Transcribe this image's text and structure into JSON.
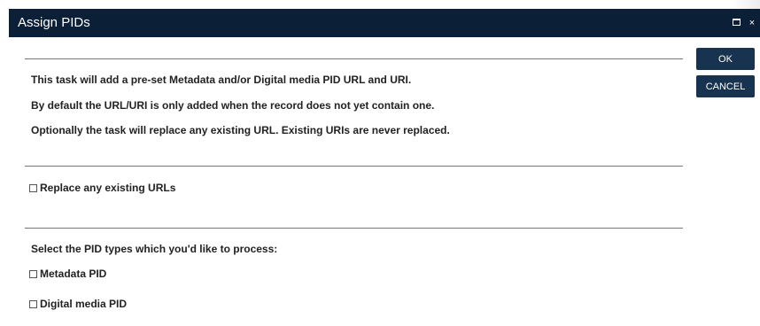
{
  "dialog": {
    "title": "Assign PIDs",
    "controls": {
      "maximize_icon": "maximize-icon",
      "close_symbol": "×"
    }
  },
  "buttons": {
    "ok": "OK",
    "cancel": "CANCEL"
  },
  "description": {
    "line1": "This task will add a pre-set Metadata and/or Digital media PID URL and URI.",
    "line2": "By default the URL/URI is only added when the record does not yet contain one.",
    "line3": "Optionally the task will replace any existing URL. Existing URIs are never replaced."
  },
  "replace_option": {
    "label": "Replace any existing URLs",
    "checked": false
  },
  "pid_types": {
    "prompt": "Select the PID types which you'd like to process:",
    "options": [
      {
        "label": "Metadata PID",
        "checked": false
      },
      {
        "label": "Digital media PID",
        "checked": false
      }
    ]
  },
  "colors": {
    "titlebar": "#0b1f36",
    "button": "#18334f"
  }
}
